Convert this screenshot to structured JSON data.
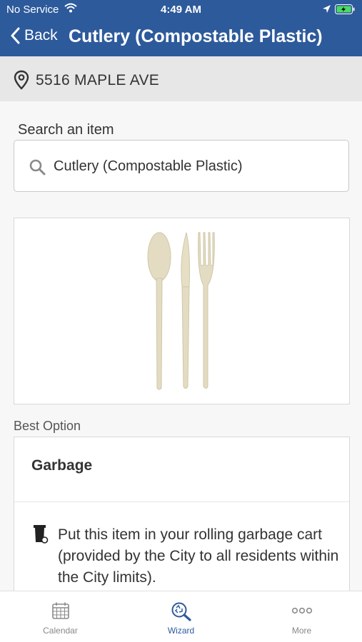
{
  "status_bar": {
    "carrier": "No Service",
    "time": "4:49 AM"
  },
  "nav": {
    "back_label": "Back",
    "title": "Cutlery (Compostable Plastic)"
  },
  "address": {
    "text": "5516 MAPLE AVE"
  },
  "search": {
    "label": "Search an item",
    "value": "Cutlery (Compostable Plastic)"
  },
  "best_option": {
    "label": "Best Option",
    "title": "Garbage",
    "description": "Put this item in your rolling garbage cart (provided by the City to all residents within the City limits)."
  },
  "tabs": [
    {
      "label": "Calendar",
      "icon": "calendar-icon",
      "active": false
    },
    {
      "label": "Wizard",
      "icon": "wizard-search-icon",
      "active": true
    },
    {
      "label": "More",
      "icon": "more-dots-icon",
      "active": false
    }
  ],
  "colors": {
    "brand": "#2d5a9b",
    "inactive_tab": "#888888"
  }
}
